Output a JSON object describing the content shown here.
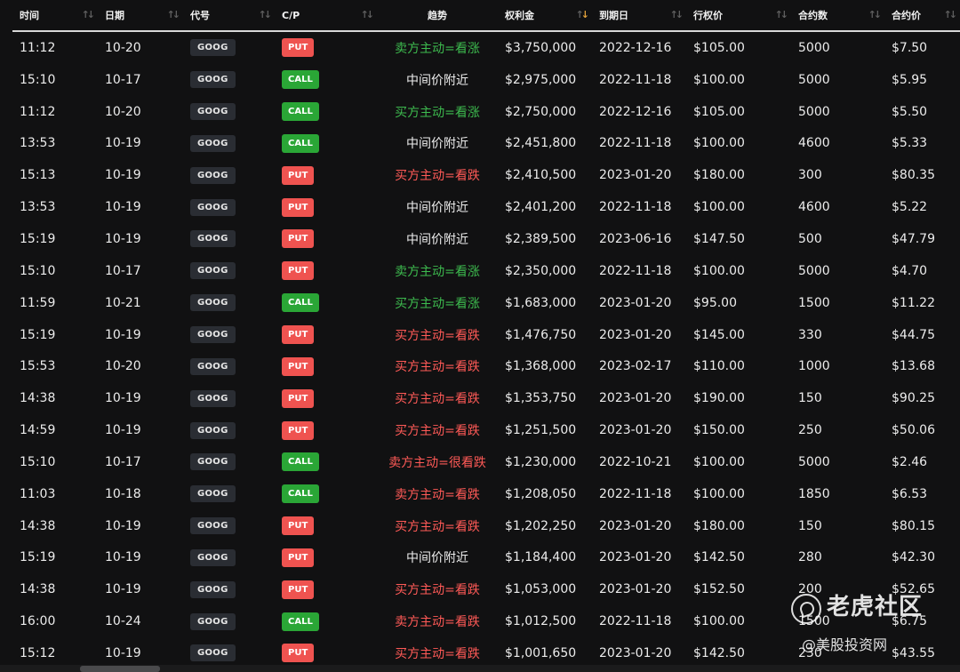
{
  "table": {
    "columns": [
      {
        "key": "time",
        "label": "时间"
      },
      {
        "key": "date",
        "label": "日期"
      },
      {
        "key": "ticker",
        "label": "代号"
      },
      {
        "key": "cp",
        "label": "C/P"
      },
      {
        "key": "trend",
        "label": "趋势"
      },
      {
        "key": "premium",
        "label": "权利金"
      },
      {
        "key": "expiry",
        "label": "到期日"
      },
      {
        "key": "strike",
        "label": "行权价"
      },
      {
        "key": "contracts",
        "label": "合约数"
      },
      {
        "key": "price",
        "label": "合约价"
      }
    ],
    "sorted_column": "premium",
    "rows": [
      {
        "time": "11:12",
        "date": "10-20",
        "ticker": "GOOG",
        "cp": "PUT",
        "trend": "卖方主动=看涨",
        "trend_color": "green",
        "premium": "$3,750,000",
        "expiry": "2022-12-16",
        "strike": "$105.00",
        "contracts": "5000",
        "price": "$7.50"
      },
      {
        "time": "15:10",
        "date": "10-17",
        "ticker": "GOOG",
        "cp": "CALL",
        "trend": "中间价附近",
        "trend_color": "white",
        "premium": "$2,975,000",
        "expiry": "2022-11-18",
        "strike": "$100.00",
        "contracts": "5000",
        "price": "$5.95"
      },
      {
        "time": "11:12",
        "date": "10-20",
        "ticker": "GOOG",
        "cp": "CALL",
        "trend": "买方主动=看涨",
        "trend_color": "green",
        "premium": "$2,750,000",
        "expiry": "2022-12-16",
        "strike": "$105.00",
        "contracts": "5000",
        "price": "$5.50"
      },
      {
        "time": "13:53",
        "date": "10-19",
        "ticker": "GOOG",
        "cp": "CALL",
        "trend": "中间价附近",
        "trend_color": "white",
        "premium": "$2,451,800",
        "expiry": "2022-11-18",
        "strike": "$100.00",
        "contracts": "4600",
        "price": "$5.33"
      },
      {
        "time": "15:13",
        "date": "10-19",
        "ticker": "GOOG",
        "cp": "PUT",
        "trend": "买方主动=看跌",
        "trend_color": "red",
        "premium": "$2,410,500",
        "expiry": "2023-01-20",
        "strike": "$180.00",
        "contracts": "300",
        "price": "$80.35"
      },
      {
        "time": "13:53",
        "date": "10-19",
        "ticker": "GOOG",
        "cp": "PUT",
        "trend": "中间价附近",
        "trend_color": "white",
        "premium": "$2,401,200",
        "expiry": "2022-11-18",
        "strike": "$100.00",
        "contracts": "4600",
        "price": "$5.22"
      },
      {
        "time": "15:19",
        "date": "10-19",
        "ticker": "GOOG",
        "cp": "PUT",
        "trend": "中间价附近",
        "trend_color": "white",
        "premium": "$2,389,500",
        "expiry": "2023-06-16",
        "strike": "$147.50",
        "contracts": "500",
        "price": "$47.79"
      },
      {
        "time": "15:10",
        "date": "10-17",
        "ticker": "GOOG",
        "cp": "PUT",
        "trend": "卖方主动=看涨",
        "trend_color": "green",
        "premium": "$2,350,000",
        "expiry": "2022-11-18",
        "strike": "$100.00",
        "contracts": "5000",
        "price": "$4.70"
      },
      {
        "time": "11:59",
        "date": "10-21",
        "ticker": "GOOG",
        "cp": "CALL",
        "trend": "买方主动=看涨",
        "trend_color": "green",
        "premium": "$1,683,000",
        "expiry": "2023-01-20",
        "strike": "$95.00",
        "contracts": "1500",
        "price": "$11.22"
      },
      {
        "time": "15:19",
        "date": "10-19",
        "ticker": "GOOG",
        "cp": "PUT",
        "trend": "买方主动=看跌",
        "trend_color": "red",
        "premium": "$1,476,750",
        "expiry": "2023-01-20",
        "strike": "$145.00",
        "contracts": "330",
        "price": "$44.75"
      },
      {
        "time": "15:53",
        "date": "10-20",
        "ticker": "GOOG",
        "cp": "PUT",
        "trend": "买方主动=看跌",
        "trend_color": "red",
        "premium": "$1,368,000",
        "expiry": "2023-02-17",
        "strike": "$110.00",
        "contracts": "1000",
        "price": "$13.68"
      },
      {
        "time": "14:38",
        "date": "10-19",
        "ticker": "GOOG",
        "cp": "PUT",
        "trend": "买方主动=看跌",
        "trend_color": "red",
        "premium": "$1,353,750",
        "expiry": "2023-01-20",
        "strike": "$190.00",
        "contracts": "150",
        "price": "$90.25"
      },
      {
        "time": "14:59",
        "date": "10-19",
        "ticker": "GOOG",
        "cp": "PUT",
        "trend": "买方主动=看跌",
        "trend_color": "red",
        "premium": "$1,251,500",
        "expiry": "2023-01-20",
        "strike": "$150.00",
        "contracts": "250",
        "price": "$50.06"
      },
      {
        "time": "15:10",
        "date": "10-17",
        "ticker": "GOOG",
        "cp": "CALL",
        "trend": "卖方主动=很看跌",
        "trend_color": "red",
        "premium": "$1,230,000",
        "expiry": "2022-10-21",
        "strike": "$100.00",
        "contracts": "5000",
        "price": "$2.46"
      },
      {
        "time": "11:03",
        "date": "10-18",
        "ticker": "GOOG",
        "cp": "CALL",
        "trend": "卖方主动=看跌",
        "trend_color": "red",
        "premium": "$1,208,050",
        "expiry": "2022-11-18",
        "strike": "$100.00",
        "contracts": "1850",
        "price": "$6.53"
      },
      {
        "time": "14:38",
        "date": "10-19",
        "ticker": "GOOG",
        "cp": "PUT",
        "trend": "买方主动=看跌",
        "trend_color": "red",
        "premium": "$1,202,250",
        "expiry": "2023-01-20",
        "strike": "$180.00",
        "contracts": "150",
        "price": "$80.15"
      },
      {
        "time": "15:19",
        "date": "10-19",
        "ticker": "GOOG",
        "cp": "PUT",
        "trend": "中间价附近",
        "trend_color": "white",
        "premium": "$1,184,400",
        "expiry": "2023-01-20",
        "strike": "$142.50",
        "contracts": "280",
        "price": "$42.30"
      },
      {
        "time": "14:38",
        "date": "10-19",
        "ticker": "GOOG",
        "cp": "PUT",
        "trend": "买方主动=看跌",
        "trend_color": "red",
        "premium": "$1,053,000",
        "expiry": "2023-01-20",
        "strike": "$152.50",
        "contracts": "200",
        "price": "$52.65"
      },
      {
        "time": "16:00",
        "date": "10-24",
        "ticker": "GOOG",
        "cp": "CALL",
        "trend": "卖方主动=看跌",
        "trend_color": "red",
        "premium": "$1,012,500",
        "expiry": "2022-11-18",
        "strike": "$100.00",
        "contracts": "1500",
        "price": "$6.75"
      },
      {
        "time": "15:12",
        "date": "10-19",
        "ticker": "GOOG",
        "cp": "PUT",
        "trend": "买方主动=看跌",
        "trend_color": "red",
        "premium": "$1,001,650",
        "expiry": "2023-01-20",
        "strike": "$142.50",
        "contracts": "230",
        "price": "$43.55"
      }
    ]
  },
  "colors": {
    "background": "#111112",
    "put": "#ef5350",
    "call": "#2aa636",
    "trend_green": "#3dba4e",
    "trend_red": "#ff5a57",
    "sort_active": "#e0a03a"
  },
  "watermark": {
    "title": "老虎社区",
    "subtitle": "@美股投资网",
    "icon": "tiger-logo-icon"
  }
}
